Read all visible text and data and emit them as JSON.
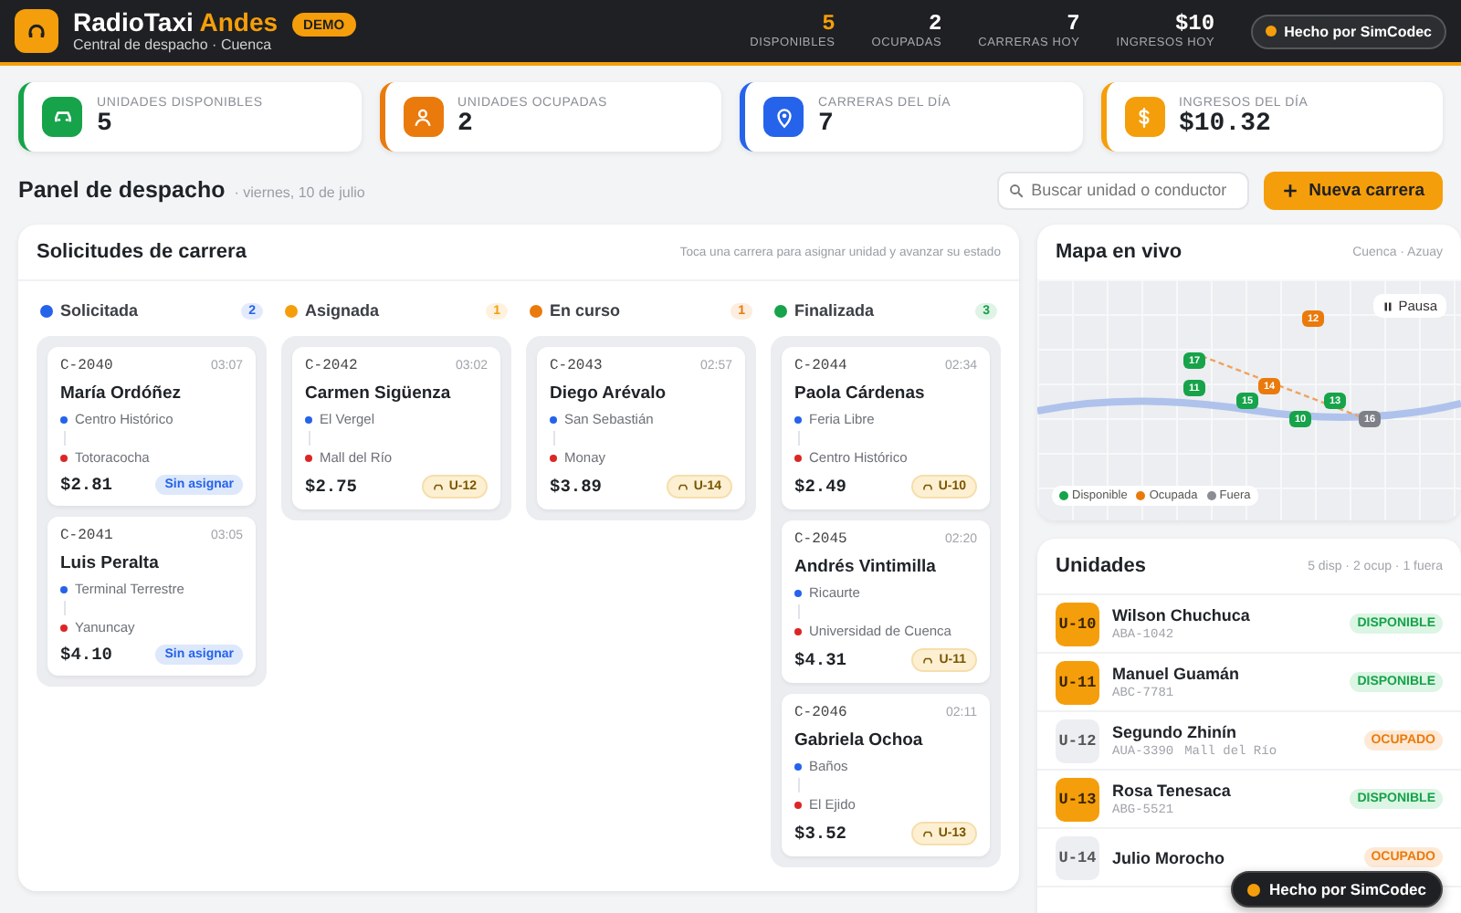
{
  "header": {
    "brand": "RadioTaxi",
    "brand_accent": "Andes",
    "badge": "DEMO",
    "subtitle": "Central de despacho · Cuenca",
    "stats": [
      {
        "value": "5",
        "label": "DISPONIBLES",
        "highlight": true
      },
      {
        "value": "2",
        "label": "OCUPADAS",
        "highlight": false
      },
      {
        "value": "7",
        "label": "CARRERAS HOY",
        "highlight": false
      },
      {
        "value": "$10",
        "label": "INGRESOS HOY",
        "highlight": false
      }
    ],
    "credit": "Hecho por SimCodec"
  },
  "stat_cards": [
    {
      "label": "UNIDADES DISPONIBLES",
      "value": "5",
      "kind": "available",
      "color": "#16a34a"
    },
    {
      "label": "UNIDADES OCUPADAS",
      "value": "2",
      "kind": "occupied",
      "color": "#ea7a0c"
    },
    {
      "label": "CARRERAS DEL DÍA",
      "value": "7",
      "kind": "rides",
      "color": "#2563eb"
    },
    {
      "label": "INGRESOS DEL DÍA",
      "value": "$10.32",
      "kind": "income",
      "color": "#f59e0b"
    }
  ],
  "toolbar": {
    "title": "Panel de despacho",
    "date": "· viernes, 10 de julio",
    "search": {
      "placeholder": "Buscar unidad o conductor"
    },
    "button": "Nueva carrera"
  },
  "board": {
    "title": "Solicitudes de carrera",
    "hint": "Toca una carrera para asignar unidad y avanzar su estado",
    "columns": [
      {
        "label": "Solicitada",
        "count": "2",
        "color": "#2563eb",
        "cards": [
          {
            "id": "C-2040",
            "time": "03:07",
            "name": "María Ordóñez",
            "from": "Centro Histórico",
            "to": "Totoracocha",
            "price": "$2.81",
            "kind": "unassigned",
            "unit": "Sin asignar"
          },
          {
            "id": "C-2041",
            "time": "03:05",
            "name": "Luis Peralta",
            "from": "Terminal Terrestre",
            "to": "Yanuncay",
            "price": "$4.10",
            "kind": "unassigned",
            "unit": "Sin asignar"
          }
        ]
      },
      {
        "label": "Asignada",
        "count": "1",
        "color": "#f59e0b",
        "cards": [
          {
            "id": "C-2042",
            "time": "03:02",
            "name": "Carmen Sigüenza",
            "from": "El Vergel",
            "to": "Mall del Río",
            "price": "$2.75",
            "kind": "unit",
            "unit": "U-12"
          }
        ]
      },
      {
        "label": "En curso",
        "count": "1",
        "color": "#ea7a0c",
        "cards": [
          {
            "id": "C-2043",
            "time": "02:57",
            "name": "Diego Arévalo",
            "from": "San Sebastián",
            "to": "Monay",
            "price": "$3.89",
            "kind": "unit",
            "unit": "U-14"
          }
        ]
      },
      {
        "label": "Finalizada",
        "count": "3",
        "color": "#16a34a",
        "cards": [
          {
            "id": "C-2044",
            "time": "02:34",
            "name": "Paola Cárdenas",
            "from": "Feria Libre",
            "to": "Centro Histórico",
            "price": "$2.49",
            "kind": "unit",
            "unit": "U-10"
          },
          {
            "id": "C-2045",
            "time": "02:20",
            "name": "Andrés Vintimilla",
            "from": "Ricaurte",
            "to": "Universidad de Cuenca",
            "price": "$4.31",
            "kind": "unit",
            "unit": "U-11"
          },
          {
            "id": "C-2046",
            "time": "02:11",
            "name": "Gabriela Ochoa",
            "from": "Baños",
            "to": "El Ejido",
            "price": "$3.52",
            "kind": "unit",
            "unit": "U-13"
          }
        ]
      }
    ]
  },
  "map": {
    "title": "Mapa en vivo",
    "location": "Cuenca · Azuay",
    "pause": "Pausa",
    "markers": [
      {
        "label": "12",
        "kind": "busy"
      },
      {
        "label": "17",
        "kind": "free"
      },
      {
        "label": "11",
        "kind": "free"
      },
      {
        "label": "14",
        "kind": "busy"
      },
      {
        "label": "15",
        "kind": "free"
      },
      {
        "label": "13",
        "kind": "free"
      },
      {
        "label": "10",
        "kind": "free"
      },
      {
        "label": "16",
        "kind": "off"
      }
    ],
    "legend": [
      {
        "label": "Disponible",
        "color": "#16a34a"
      },
      {
        "label": "Ocupada",
        "color": "#ea7a0c"
      },
      {
        "label": "Fuera",
        "color": "#8a8d93"
      }
    ]
  },
  "units": {
    "title": "Unidades",
    "summary": "5 disp · 2 ocup · 1 fuera",
    "rows": [
      {
        "code": "U-10",
        "name": "Wilson Chuchuca",
        "plate": "ABA-1042",
        "status": "DISPONIBLE",
        "kind": "free"
      },
      {
        "code": "U-11",
        "name": "Manuel Guamán",
        "plate": "ABC-7781",
        "status": "DISPONIBLE",
        "kind": "free"
      },
      {
        "code": "U-12",
        "name": "Segundo Zhinín",
        "plate": "AUA-3390",
        "place": "Mall del Río",
        "status": "OCUPADO",
        "kind": "busy"
      },
      {
        "code": "U-13",
        "name": "Rosa Tenesaca",
        "plate": "ABG-5521",
        "status": "DISPONIBLE",
        "kind": "free"
      },
      {
        "code": "U-14",
        "name": "Julio Morocho",
        "status": "OCUPADO",
        "kind": "busy"
      }
    ]
  },
  "floating_badge": "Hecho por SimCodec"
}
